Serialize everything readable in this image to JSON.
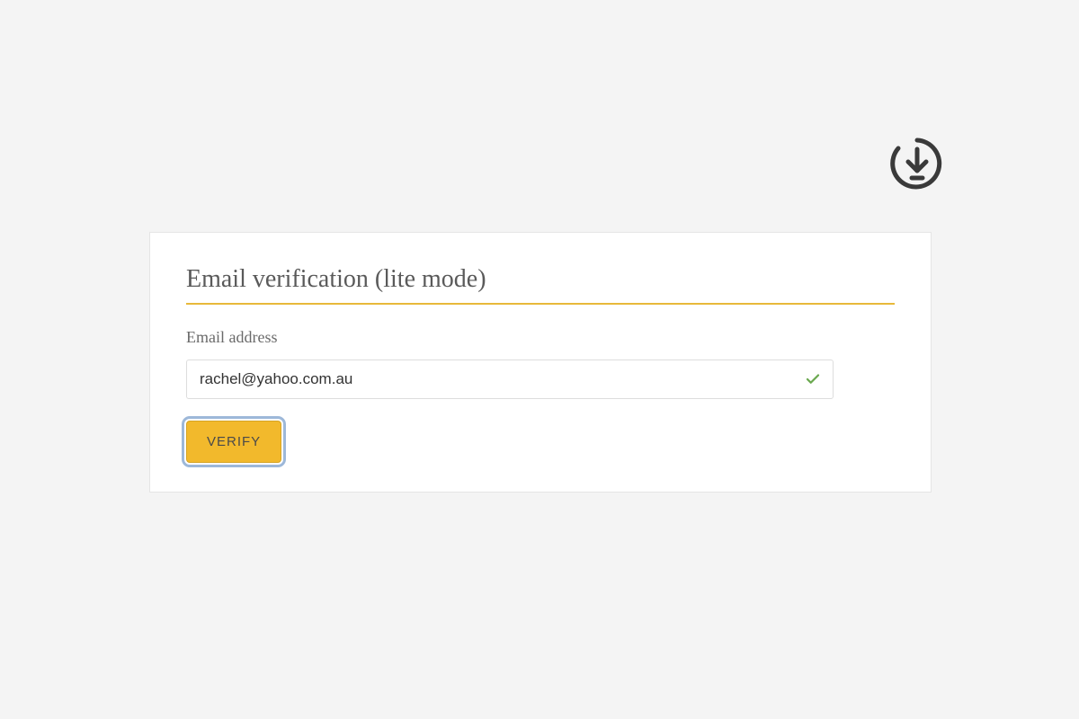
{
  "panel": {
    "title": "Email verification (lite mode)",
    "field_label": "Email address",
    "email_value": "rachel@yahoo.com.au",
    "verify_label": "VERIFY"
  }
}
